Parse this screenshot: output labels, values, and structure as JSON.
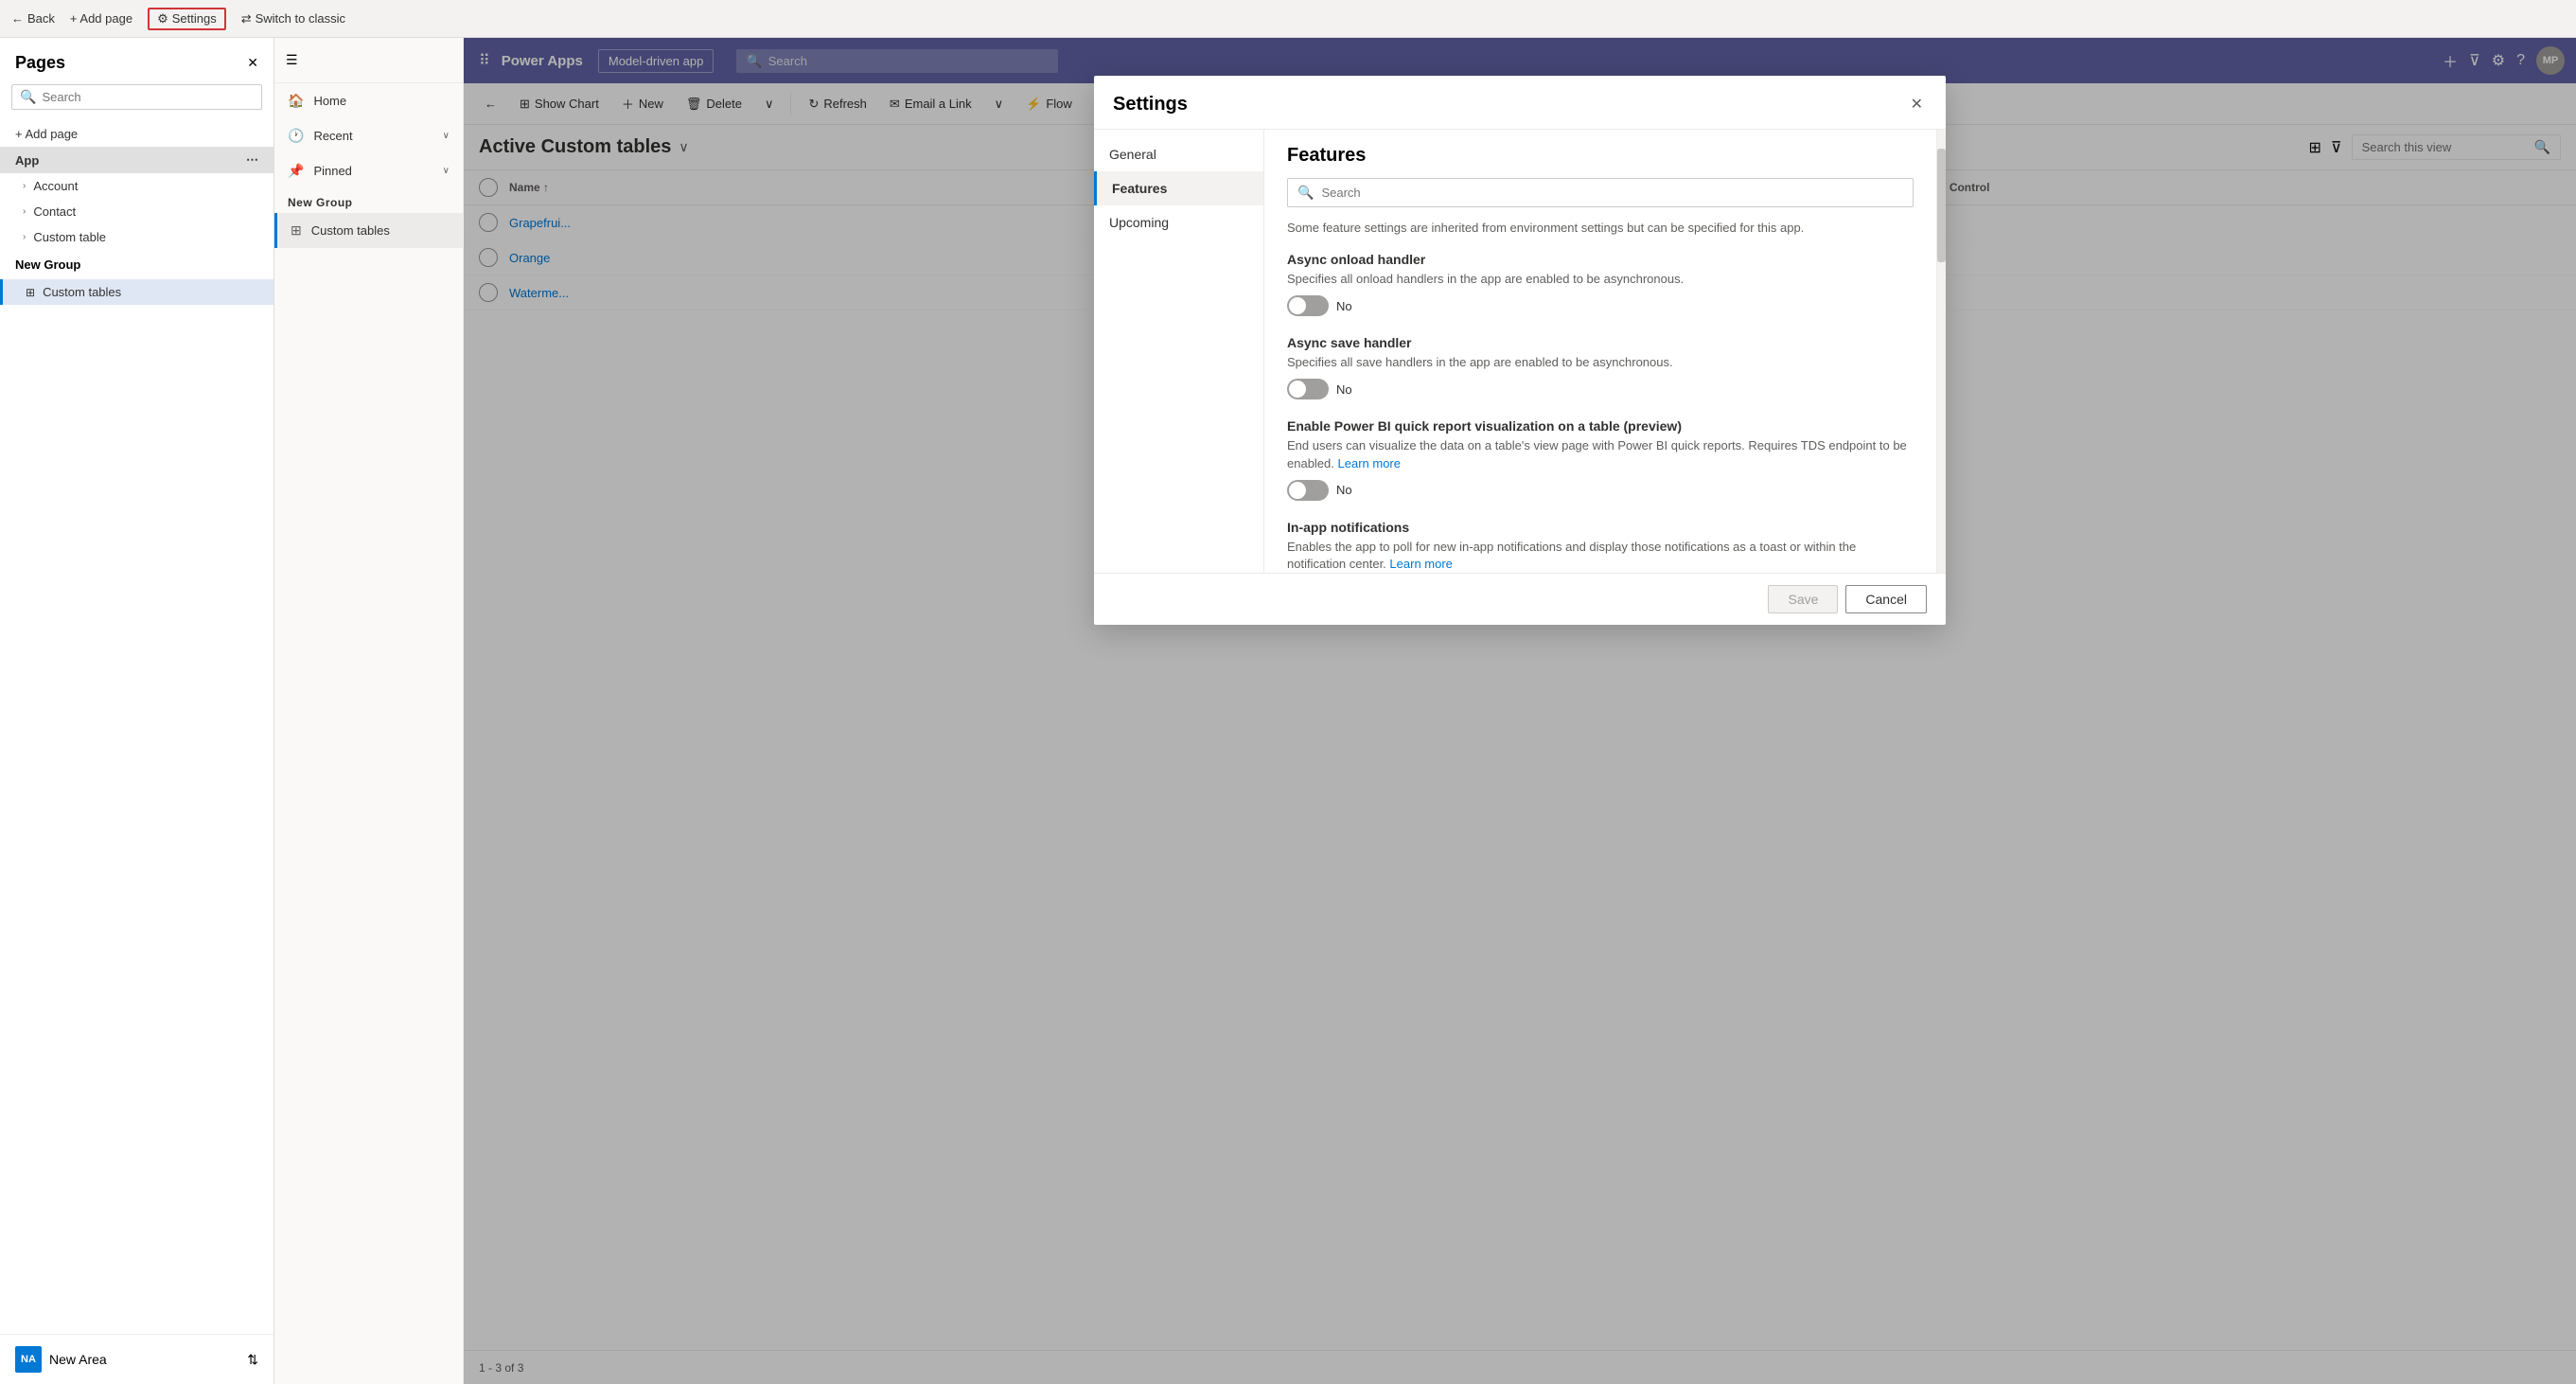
{
  "browser": {
    "back_label": "Back",
    "add_page_label": "+ Add page",
    "settings_label": "Settings",
    "switch_label": "Switch to classic"
  },
  "pages_panel": {
    "title": "Pages",
    "search_placeholder": "Search",
    "add_page": "+ Add page",
    "app_item": "App",
    "account_item": "Account",
    "contact_item": "Contact",
    "custom_table_item": "Custom table",
    "new_group": "New Group",
    "custom_tables": "Custom tables",
    "new_area_label": "NA",
    "new_area_text": "New Area",
    "pages_count": "1 - 3 of 3"
  },
  "nav_sidebar": {
    "items": [
      {
        "label": "Home",
        "icon": "🏠"
      },
      {
        "label": "Recent",
        "icon": "🕐"
      },
      {
        "label": "Pinned",
        "icon": "📌"
      }
    ]
  },
  "app_bar": {
    "brand": "Power Apps",
    "app_name": "Model-driven app",
    "search_placeholder": "Search",
    "avatar": "MP"
  },
  "command_bar": {
    "show_chart": "Show Chart",
    "new": "New",
    "delete": "Delete",
    "refresh": "Refresh",
    "email_link": "Email a Link",
    "flow": "Flow"
  },
  "view": {
    "title": "Active Custom tables",
    "search_placeholder": "Search this view"
  },
  "table": {
    "rows": [
      {
        "name": "Grapefrui..."
      },
      {
        "name": "Orange"
      },
      {
        "name": "Waterme..."
      }
    ]
  },
  "status_bar": {
    "count": "1 - 3 of 3"
  },
  "settings_dialog": {
    "title": "Settings",
    "close_icon": "✕",
    "nav_items": [
      {
        "label": "General",
        "active": false
      },
      {
        "label": "Features",
        "active": true
      },
      {
        "label": "Upcoming",
        "active": false
      }
    ],
    "content_title": "Features",
    "search_placeholder": "Search",
    "info_text": "Some feature settings are inherited from environment settings but can be specified for this app.",
    "features": [
      {
        "title": "Async onload handler",
        "desc": "Specifies all onload handlers in the app are enabled to be asynchronous.",
        "toggle_state": false,
        "toggle_label": "No",
        "has_link": false
      },
      {
        "title": "Async save handler",
        "desc": "Specifies all save handlers in the app are enabled to be asynchronous.",
        "toggle_state": false,
        "toggle_label": "No",
        "has_link": false
      },
      {
        "title": "Enable Power BI quick report visualization on a table (preview)",
        "desc": "End users can visualize the data on a table's view page with Power BI quick reports. Requires TDS endpoint to be enabled.",
        "link_text": "Learn more",
        "toggle_state": false,
        "toggle_label": "No",
        "has_link": true
      },
      {
        "title": "In-app notifications",
        "desc": "Enables the app to poll for new in-app notifications and display those notifications as a toast or within the notification center.",
        "link_text": "Learn more",
        "toggle_state": false,
        "toggle_label": "",
        "has_link": true
      }
    ],
    "save_label": "Save",
    "cancel_label": "Cancel"
  }
}
